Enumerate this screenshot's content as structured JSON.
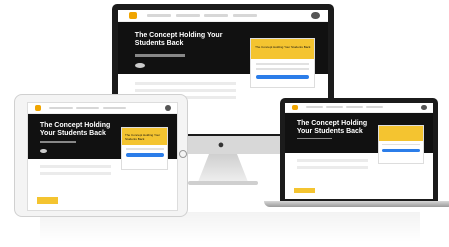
{
  "hero": {
    "title": "The Concept Holding Your Students Back"
  },
  "card": {
    "image_text": "The Concept Holding Your Students Back"
  },
  "device_icons": {
    "apple": "apple-logo-icon"
  },
  "colors": {
    "accent_yellow": "#f4c430",
    "button_blue": "#2b7de9",
    "hero_black": "#111111"
  }
}
